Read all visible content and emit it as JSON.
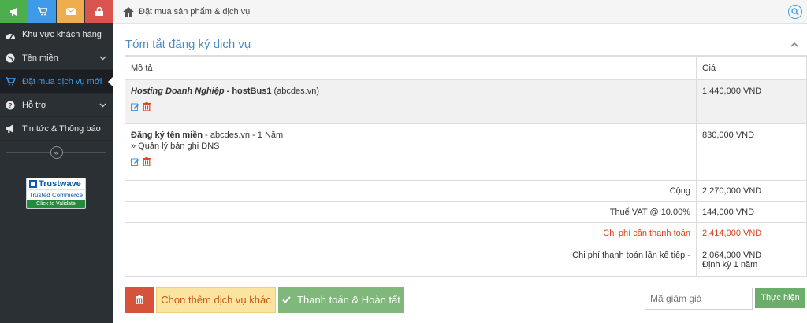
{
  "sidebar": {
    "top_buttons": [
      {
        "icon": "megaphone-icon",
        "color": "#4cae4c"
      },
      {
        "icon": "cart-icon",
        "color": "#3d9be9"
      },
      {
        "icon": "envelope-icon",
        "color": "#f0ad4e"
      },
      {
        "icon": "lock-icon",
        "color": "#d9534f"
      }
    ],
    "items": [
      {
        "label": "Khu vực khách hàng",
        "icon": "dashboard-icon"
      },
      {
        "label": "Tên miền",
        "icon": "globe-icon"
      },
      {
        "label": "Đặt mua dịch vụ mới",
        "icon": "cart-icon"
      },
      {
        "label": "Hỗ trợ",
        "icon": "question-icon"
      },
      {
        "label": "Tin tức & Thông báo",
        "icon": "megaphone-icon"
      }
    ],
    "collapse_glyph": "«",
    "badge": {
      "brand": "Trustwave",
      "sub": "Trusted Commerce",
      "validate": "Click to Validate"
    }
  },
  "header": {
    "breadcrumb": "Đặt mua sản phẩm & dịch vụ"
  },
  "panel": {
    "title": "Tóm tắt đăng ký dịch vụ",
    "col_desc": "Mô tả",
    "col_price": "Giá",
    "item1": {
      "name": "Hosting Doanh Nghiệp",
      "sep": " - ",
      "plan": "hostBus1",
      "domain": " (abcdes.vn)",
      "price": "1,440,000 VND"
    },
    "item2": {
      "name": "Đăng ký tên miền",
      "detail": " - abcdes.vn - 1 Năm",
      "addon": "» Quản lý bản ghi DNS",
      "price": "830,000 VND"
    },
    "subtotal_label": "Cộng",
    "subtotal_value": "2,270,000 VND",
    "vat_label": "Thuế VAT @ 10.00%",
    "vat_value": "144,000 VND",
    "total_label": "Chi phí cần thanh toán",
    "total_value": "2,414,000 VND",
    "next_label": "Chi phí thanh toán lần kế tiếp -",
    "next_value": "2,064,000 VND",
    "next_cycle": "Định kỳ 1 năm"
  },
  "actions": {
    "more_label": "Chọn thêm dịch vụ khác",
    "checkout_label": "Thanh toán & Hoàn tất",
    "coupon_placeholder": "Mã giảm giá",
    "apply_label": "Thực hiện"
  }
}
